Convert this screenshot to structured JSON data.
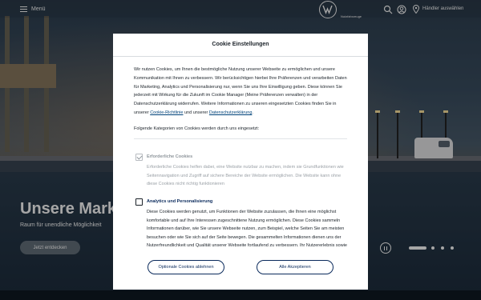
{
  "header": {
    "menu_label": "Menü",
    "brand_tag": "Nutzfahrzeuge",
    "dealer_label": "Händler auswählen"
  },
  "hero": {
    "title": "Unsere Marke",
    "subtitle": "Raum für unendliche Möglichkeit",
    "cta_label": "Jetzt entdecken"
  },
  "modal": {
    "title": "Cookie Einstellungen",
    "intro": {
      "text": "Wir nutzen Cookies, um Ihnen die bestmögliche Nutzung unserer Webseite zu ermöglichen und unsere Kommunikation mit Ihnen zu verbessern. Wir berücksichtigen hierbei Ihre Präferenzen und verarbeiten Daten für Marketing, Analytics und Personalisierung nur, wenn Sie uns Ihre Einwilligung geben. Diese können Sie jederzeit mit Wirkung für die Zukunft im Cookie Manager (Meine Präferenzen verwalten) in der Datenschutzerklärung widerrufen. Weitere Informationen zu unseren eingesetzten Cookies finden Sie in unserer ",
      "link1": "Cookie-Richtlinie",
      "mid": " und unserer ",
      "link2": "Datenschutzerklärung",
      "end": "."
    },
    "categories_heading": "Folgende Kategorien von Cookies werden durch uns eingesetzt:",
    "categories": [
      {
        "title": "Erforderliche Cookies",
        "checked": true,
        "disabled": true,
        "description": "Erforderliche Cookies helfen dabei, eine Website nutzbar zu machen, indem sie Grundfunktionen wie Seitennavigation und Zugriff auf sichere Bereiche der Website ermöglichen. Die Website kann ohne diese Cookies nicht richtig funktionieren"
      },
      {
        "title": "Analytics und Personalisierung",
        "checked": false,
        "disabled": false,
        "description": "Diese Cookies werden genutzt, um Funktionen der Website zuzulassen, die Ihnen eine möglichst komfortable und auf Ihre Interessen zugeschnittene Nutzung ermöglichen. Diese Cookies sammeln Informationen darüber, wie Sie unsere Webseite nutzen, zum Beispiel, welche Seiten Sie am meisten besuchen oder wie Sie sich auf der Seite bewegen. Die gesammelten Informationen dienen uns der Nutzerfreundlichkeit und Qualität unserer Webseite fortlaufend zu verbessern. Ihr Nutzererlebnis sowie"
      }
    ],
    "buttons": {
      "decline": "Optionale Cookies ablehnen",
      "accept": "Alle Akzeptieren"
    }
  },
  "colors": {
    "brand_dark": "#0a2a5c",
    "text": "#1b2229",
    "link": "#00437a",
    "muted": "#8f969c"
  },
  "icons": [
    "menu-icon",
    "vw-logo",
    "search-icon",
    "account-icon",
    "location-pin-icon",
    "pause-icon",
    "checkmark-icon"
  ]
}
